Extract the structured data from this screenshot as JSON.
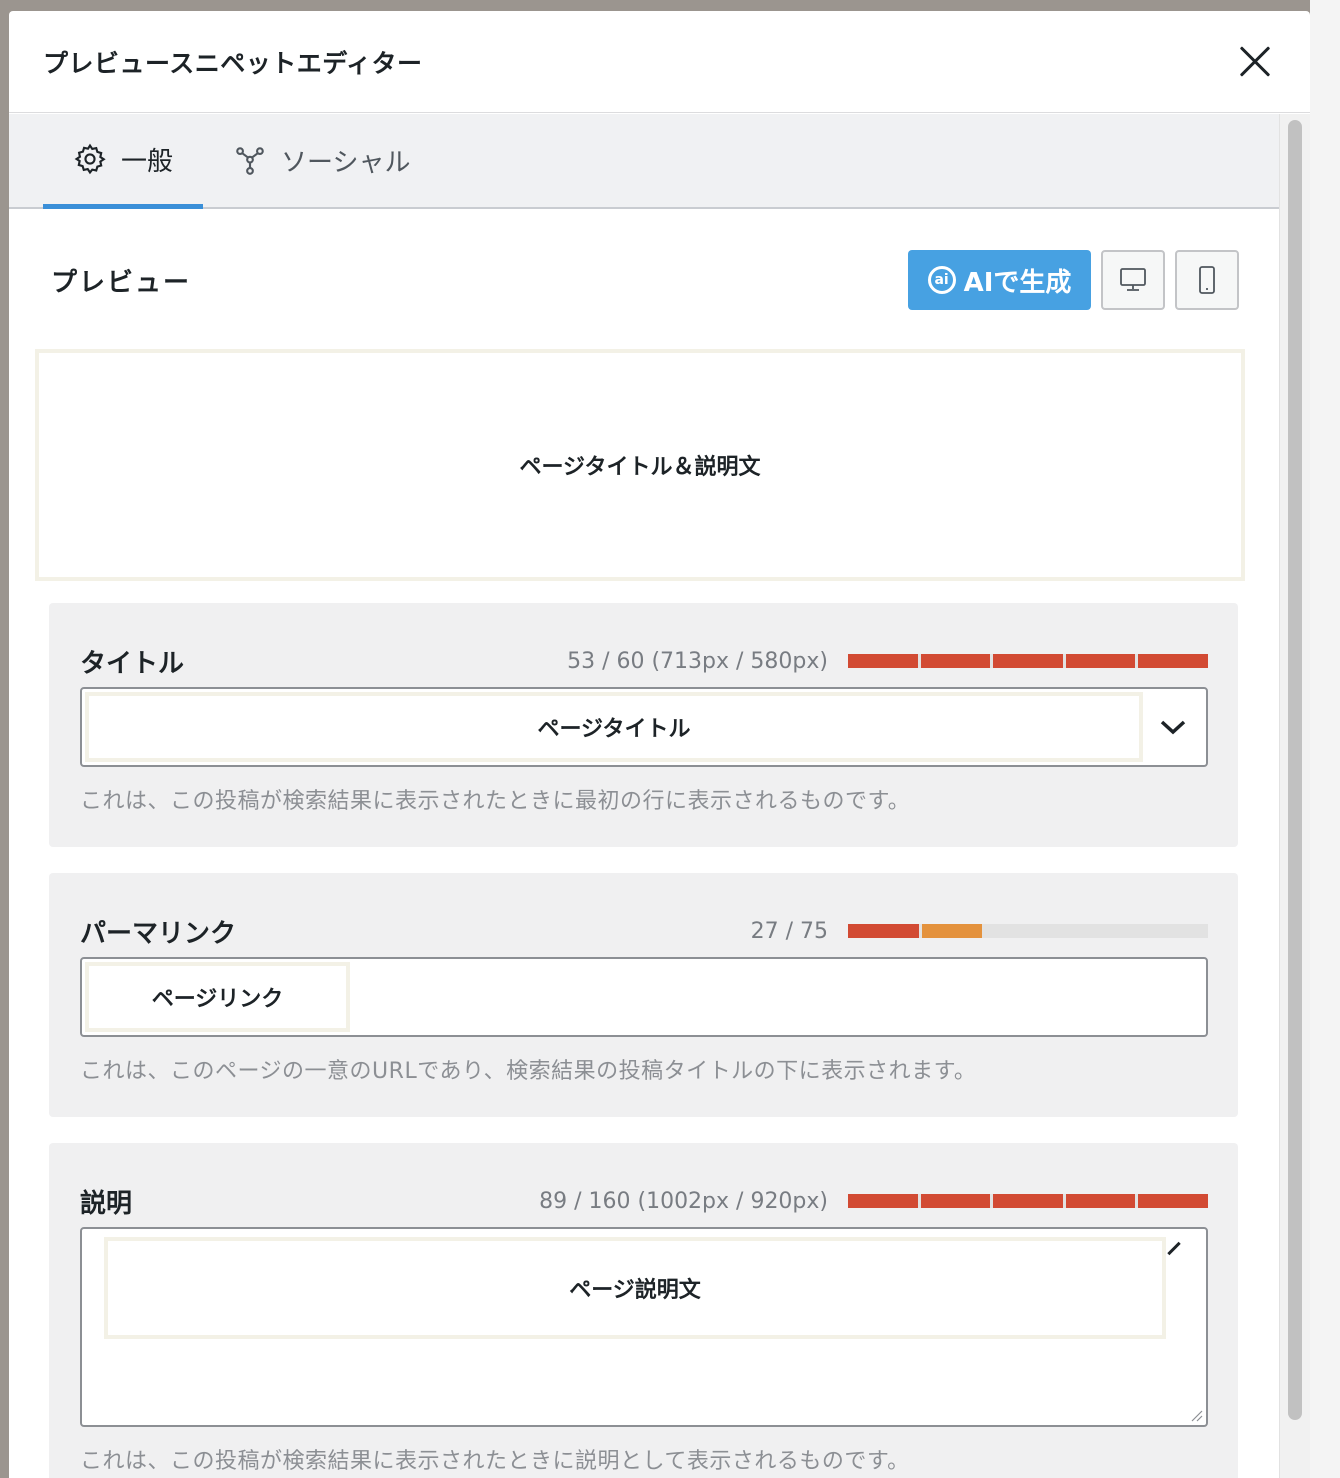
{
  "modal": {
    "title": "プレビュースニペットエディター"
  },
  "tabs": [
    {
      "label": "一般",
      "icon": "gear-icon",
      "active": true
    },
    {
      "label": "ソーシャル",
      "icon": "share-icon",
      "active": false
    }
  ],
  "preview": {
    "label": "プレビュー",
    "ai_button": "AIで生成",
    "ai_icon_text": "ai",
    "box_text": "ページタイトル＆説明文"
  },
  "title_section": {
    "label": "タイトル",
    "counter": "53 / 60 (713px / 580px)",
    "fill_ratio": 1.0,
    "value": "ページタイトル",
    "help": "これは、この投稿が検索結果に表示されたときに最初の行に表示されるものです。"
  },
  "permalink_section": {
    "label": "パーマリンク",
    "counter": "27 / 75",
    "fill_ratio": 0.36,
    "value": "ページリンク",
    "help": "これは、このページの一意のURLであり、検索結果の投稿タイトルの下に表示されます。"
  },
  "description_section": {
    "label": "説明",
    "counter": "89 / 160 (1002px / 920px)",
    "fill_ratio": 1.0,
    "value": "ページ説明文",
    "help": "これは、この投稿が検索結果に表示されたときに説明として表示されるものです。"
  },
  "colors": {
    "accent": "#47a1e2",
    "tab_underline": "#3a8fd8",
    "meter_red": "#d24a33",
    "meter_orange": "#e4923d"
  }
}
